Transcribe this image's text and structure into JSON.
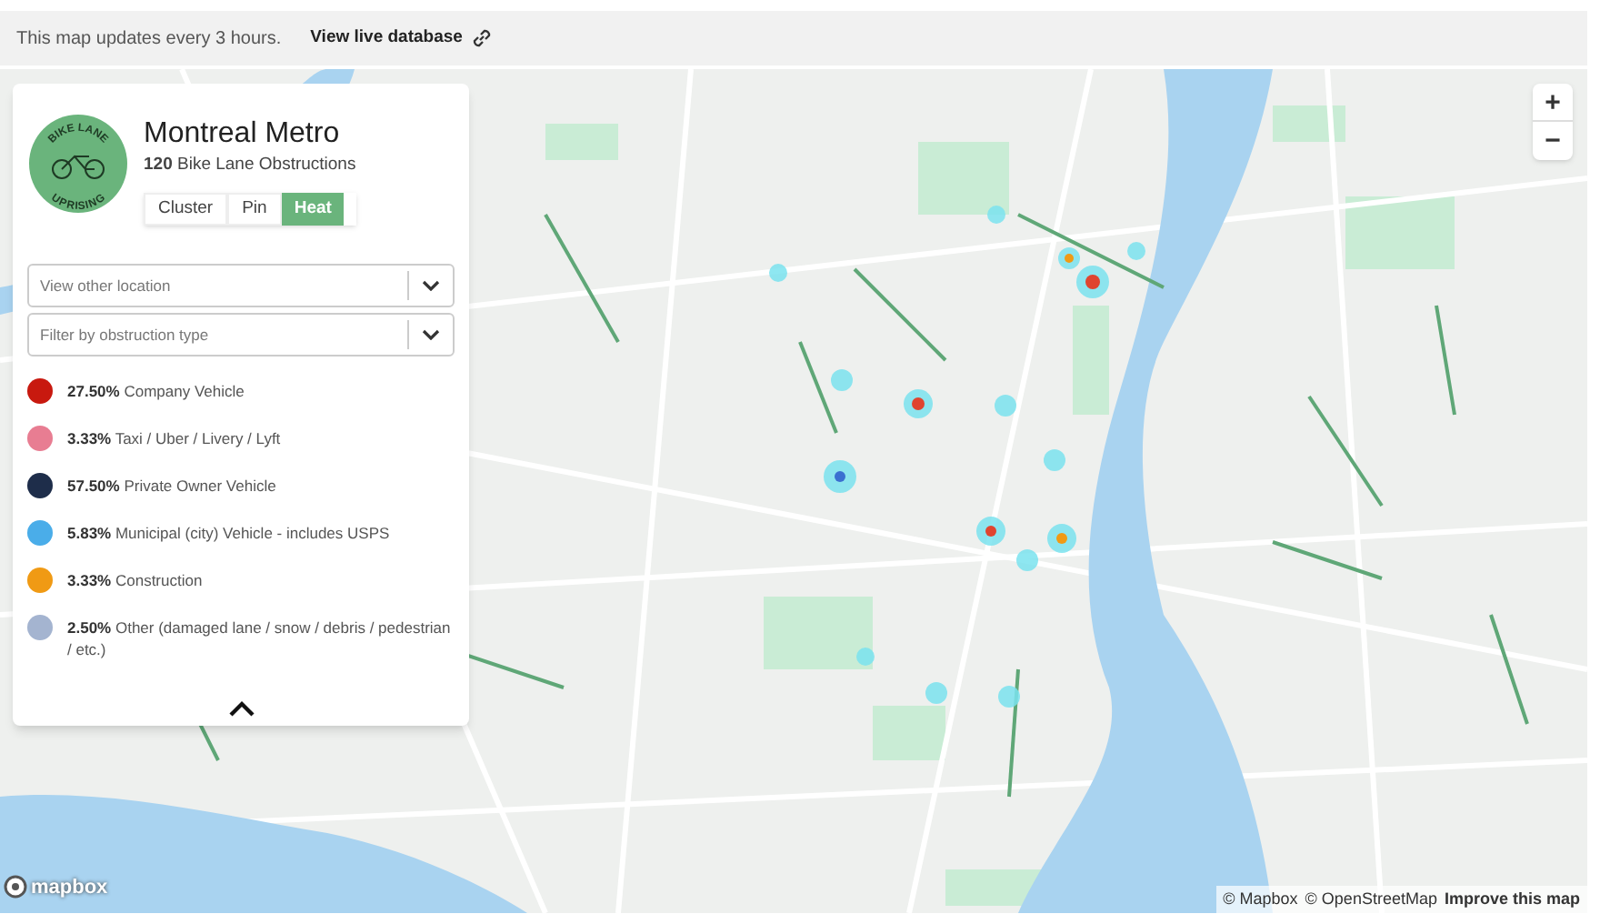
{
  "header": {
    "notice": "This map updates every 3 hours.",
    "link": "View live database"
  },
  "panel": {
    "logo": {
      "top_text": "BIKE LANE",
      "bottom_text": "UPRISING"
    },
    "title": "Montreal Metro",
    "count": "120",
    "count_label": "Bike Lane Obstructions",
    "view_modes": [
      {
        "label": "Cluster",
        "selected": false
      },
      {
        "label": "Pin",
        "selected": false
      },
      {
        "label": "Heat",
        "selected": true
      }
    ],
    "dropdowns": [
      {
        "placeholder": "View other location"
      },
      {
        "placeholder": "Filter by obstruction type"
      }
    ],
    "legend": [
      {
        "percent": "27.50%",
        "label": "Company Vehicle",
        "color": "#c8190f"
      },
      {
        "percent": "3.33%",
        "label": "Taxi / Uber / Livery / Lyft",
        "color": "#e87d92"
      },
      {
        "percent": "57.50%",
        "label": "Private Owner Vehicle",
        "color": "#1e2d4a"
      },
      {
        "percent": "5.83%",
        "label": "Municipal (city) Vehicle - includes USPS",
        "color": "#4aade9"
      },
      {
        "percent": "3.33%",
        "label": "Construction",
        "color": "#f09a14"
      },
      {
        "percent": "2.50%",
        "label": "Other (damaged lane / snow / debris / pedestrian / etc.)",
        "color": "#a4b4d0"
      }
    ]
  },
  "map": {
    "zoom_in": "+",
    "zoom_out": "−",
    "logo": "mapbox",
    "attribution": [
      "© Mapbox",
      "© OpenStreetMap",
      "Improve this map"
    ]
  }
}
